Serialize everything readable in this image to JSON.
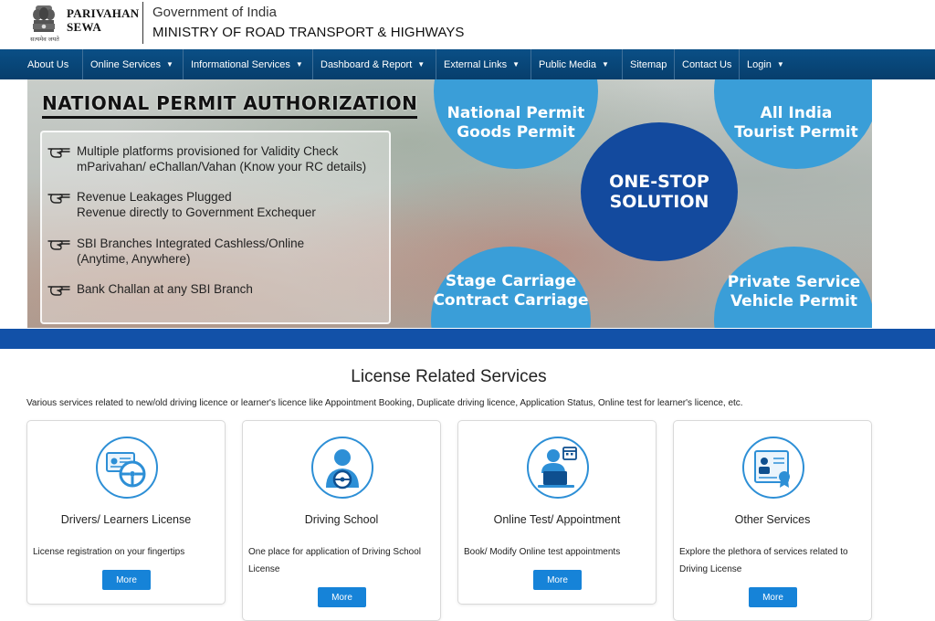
{
  "header": {
    "brand_line1": "PARIVAHAN",
    "brand_line2": "SEWA",
    "emblem_motto": "सत्यमेव जयते",
    "government": "Government of India",
    "ministry": "MINISTRY OF ROAD TRANSPORT & HIGHWAYS"
  },
  "nav": {
    "items": [
      {
        "label": "About Us",
        "dropdown": false
      },
      {
        "label": "Online Services",
        "dropdown": true
      },
      {
        "label": "Informational Services",
        "dropdown": true
      },
      {
        "label": "Dashboard & Report",
        "dropdown": true
      },
      {
        "label": "External Links",
        "dropdown": true
      },
      {
        "label": "Public Media",
        "dropdown": true
      },
      {
        "label": "Sitemap",
        "dropdown": false
      },
      {
        "label": "Contact Us",
        "dropdown": false
      },
      {
        "label": "Login",
        "dropdown": true
      }
    ],
    "caret": "▼ ▾"
  },
  "banner": {
    "title": "NATIONAL PERMIT AUTHORIZATION",
    "features": [
      {
        "line1": "Multiple platforms provisioned for Validity Check",
        "line2": "mParivahan/ eChallan/Vahan (Know your RC details)"
      },
      {
        "line1": "Revenue Leakages Plugged",
        "line2": "Revenue directly to Government Exchequer"
      },
      {
        "line1": "SBI Branches Integrated Cashless/Online",
        "line2": "(Anytime, Anywhere)"
      },
      {
        "line1": "Bank Challan at any SBI Branch",
        "line2": ""
      }
    ],
    "circles": {
      "national_goods": {
        "line1": "National Permit",
        "line2": "Goods Permit"
      },
      "all_india_tourist": {
        "line1": "All India",
        "line2": "Tourist Permit"
      },
      "one_stop": {
        "line1": "ONE-STOP",
        "line2": "SOLUTION"
      },
      "stage_carriage": {
        "line1": "Stage Carriage",
        "line2": "Contract Carriage"
      },
      "private_service": {
        "line1": "Private Service",
        "line2": "Vehicle Permit"
      }
    }
  },
  "license": {
    "title": "License Related Services",
    "description": "Various services related to new/old driving licence or learner's licence like Appointment Booking, Duplicate driving licence, Application Status, Online test for learner's licence, etc.",
    "cards": [
      {
        "title": "Drivers/ Learners License",
        "description": "License registration on your fingertips",
        "button": "More",
        "icon": "driving-licence-icon"
      },
      {
        "title": "Driving School",
        "description": "One place for application of Driving School License",
        "button": "More",
        "icon": "driver-steering-icon"
      },
      {
        "title": "Online Test/ Appointment",
        "description": "Book/ Modify Online test appointments",
        "button": "More",
        "icon": "online-test-icon"
      },
      {
        "title": "Other Services",
        "description": "Explore the plethora of services related to Driving License",
        "button": "More",
        "icon": "certificate-icon"
      }
    ]
  },
  "colors": {
    "nav_bg": "#0a4f86",
    "accent_blue": "#134a9e",
    "circle_blue": "#3a9ed8",
    "button_blue": "#1683d8"
  }
}
